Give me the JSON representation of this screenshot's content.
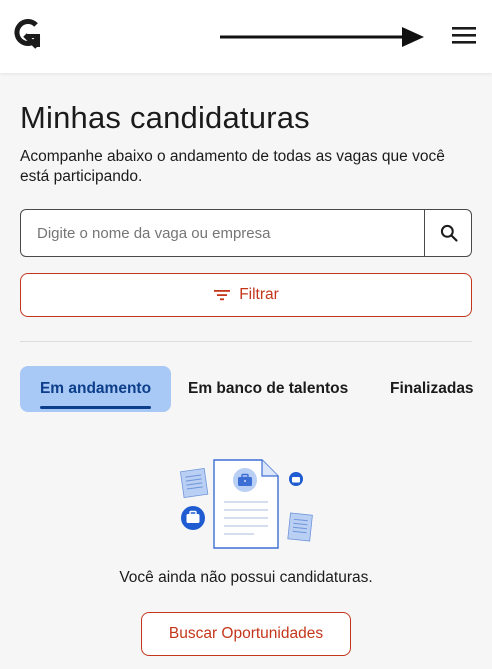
{
  "header": {
    "logo_icon": "gupy-g-logo-icon",
    "arrow_icon": "arrow-right-icon",
    "menu_icon": "hamburger-menu-icon"
  },
  "page": {
    "title": "Minhas candidaturas",
    "subtitle": "Acompanhe abaixo o andamento de todas as vagas que você está participando."
  },
  "search": {
    "placeholder": "Digite o nome da vaga ou empresa",
    "value": "",
    "icon": "search-icon"
  },
  "filter": {
    "label": "Filtrar",
    "icon": "filter-icon"
  },
  "tabs": [
    {
      "label": "Em andamento",
      "active": true
    },
    {
      "label": "Em banco de talentos",
      "active": false
    },
    {
      "label": "Finalizadas",
      "active": false
    }
  ],
  "empty_state": {
    "illustration": "documents-illustration",
    "message": "Você ainda não possui candidaturas.",
    "cta_label": "Buscar Oportunidades"
  },
  "colors": {
    "accent": "#c4361b",
    "tab_active_bg": "#a8c8f5",
    "tab_active_text": "#0d3e8a",
    "illustration_blue": "#1f5bd1"
  }
}
